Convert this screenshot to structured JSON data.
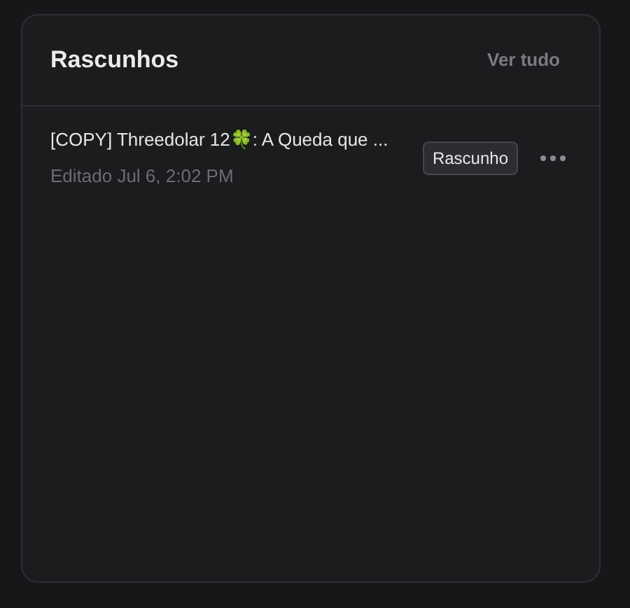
{
  "card": {
    "title": "Rascunhos",
    "view_all": "Ver tudo"
  },
  "drafts": [
    {
      "title": "[COPY] Threedolar 12🍀: A Queda que ...",
      "edited": "Editado Jul 6, 2:02 PM",
      "badge": "Rascunho"
    }
  ]
}
